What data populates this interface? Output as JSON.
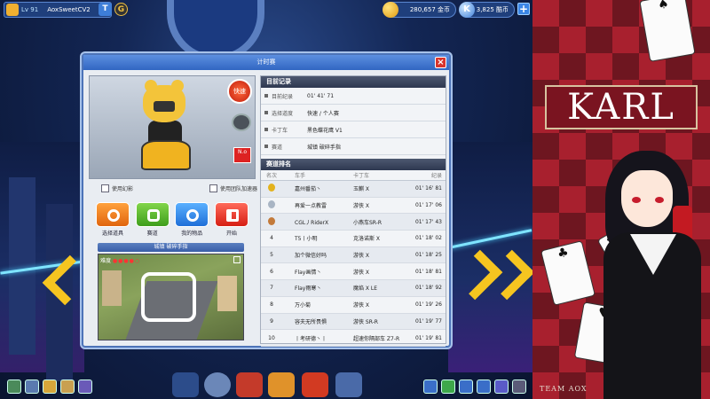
{
  "topbar": {
    "level": "Lv 91",
    "username": "AoxSweetCV2",
    "gold": "280,657 金币",
    "kcoin": "3,825 酷币",
    "t_label": "T",
    "g_label": "G",
    "plus": "+"
  },
  "dialog": {
    "title": "计时赛",
    "close": "×",
    "speed_label": "快速",
    "no_label": "N.o",
    "checkbox_ghost": "使用幻影",
    "checkbox_team": "使用团队加速器",
    "actions": [
      {
        "label": "选择道具"
      },
      {
        "label": "赛道"
      },
      {
        "label": "我的物品"
      },
      {
        "label": "开始"
      }
    ],
    "track_name": "城镇 破碎手指",
    "difficulty_label": "难度",
    "difficulty_stars": "●●●●○",
    "record_section": "目前记录",
    "records": [
      {
        "key": "目前纪录",
        "value": "01' 41' 71"
      },
      {
        "key": "选择道度",
        "value": "快速 / 个人赛"
      },
      {
        "key": "卡丁车",
        "value": "黑色蝶花鹰 V1"
      },
      {
        "key": "赛道",
        "value": "城镇 破碎手指"
      }
    ],
    "rank_section": "赛道排名",
    "rank_headers": [
      "名次",
      "车手",
      "卡丁车",
      "纪录"
    ],
    "ranks": [
      {
        "rank": "",
        "driver": "嘉州番茄丶",
        "kart": "玉麒 X",
        "time": "01' 16' 81"
      },
      {
        "rank": "",
        "driver": "再爱一点教雷",
        "kart": "游侠 X",
        "time": "01' 17' 06"
      },
      {
        "rank": "",
        "driver": "CGL丿RiderX",
        "kart": "小燕车SR-R",
        "time": "01' 17' 43"
      },
      {
        "rank": "4",
        "driver": "T5丨小明",
        "kart": "克洛诺斯 X",
        "time": "01' 18' 02"
      },
      {
        "rank": "5",
        "driver": "加个微信好吗",
        "kart": "游侠 X",
        "time": "01' 18' 25"
      },
      {
        "rank": "6",
        "driver": "Flay画情丶",
        "kart": "游侠 X",
        "time": "01' 18' 81"
      },
      {
        "rank": "7",
        "driver": "Flay雨寒丶",
        "kart": "魔焰 X LE",
        "time": "01' 18' 92"
      },
      {
        "rank": "8",
        "driver": "万小菊",
        "kart": "游侠 X",
        "time": "01' 19' 26"
      },
      {
        "rank": "9",
        "driver": "容夫无所畏惧",
        "kart": "游侠 SR-R",
        "time": "01' 19' 77"
      },
      {
        "rank": "10",
        "driver": "丨考研德丶丨",
        "kart": "超速你隔部车 Z7-R",
        "time": "01' 19' 81"
      }
    ]
  },
  "side": {
    "karl": "KARL",
    "team": "TEAM AOX"
  },
  "colors": {
    "accent": "#3166c2",
    "danger": "#d8342c",
    "panel": "#e9edf2"
  }
}
